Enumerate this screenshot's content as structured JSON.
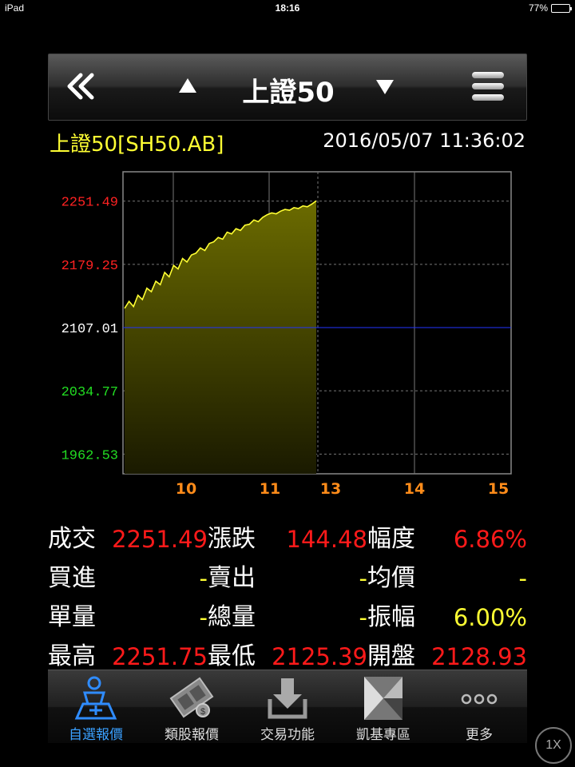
{
  "status_bar": {
    "device": "iPad",
    "time": "18:16",
    "battery": "77%",
    "battery_level": 0.77
  },
  "nav": {
    "title": "上證50",
    "back_icon": "double-chevron-left-icon",
    "prev_icon": "up-triangle-icon",
    "next_icon": "down-triangle-icon",
    "menu_icon": "hamburger-menu-icon"
  },
  "quote": {
    "name": "上證50[SH50.AB]",
    "datetime": "2016/05/07 11:36:02"
  },
  "chart_data": {
    "type": "area",
    "y_ticks": [
      {
        "label": "2251.49",
        "value": 2251.49,
        "color": "#ff2222"
      },
      {
        "label": "2179.25",
        "value": 2179.25,
        "color": "#ff2222"
      },
      {
        "label": "2107.01",
        "value": 2107.01,
        "color": "#ffffff"
      },
      {
        "label": "2034.77",
        "value": 2034.77,
        "color": "#22dd22"
      },
      {
        "label": "1962.53",
        "value": 1962.53,
        "color": "#22dd22"
      }
    ],
    "x_ticks": [
      "10",
      "11",
      "13",
      "14",
      "15"
    ],
    "ylim": [
      1940,
      2285
    ],
    "reference_line": 2107.01,
    "series": [
      {
        "values": [
          2128.93,
          2137,
          2131,
          2144,
          2139,
          2152,
          2148,
          2160,
          2156,
          2170,
          2165,
          2178,
          2174,
          2186,
          2182,
          2190,
          2192,
          2198,
          2195,
          2203,
          2205,
          2210,
          2208,
          2216,
          2214,
          2220,
          2218,
          2224,
          2225,
          2230,
          2228,
          2233,
          2236,
          2238,
          2237,
          2240,
          2242,
          2241,
          2244,
          2243,
          2246,
          2245,
          2248,
          2251.75
        ]
      }
    ],
    "colors": {
      "line": "#ffff33",
      "fill_top": "#6b6b00",
      "fill_bottom": "#1a1a00",
      "ref": "#2233ff",
      "grid": "#777777"
    }
  },
  "stats": [
    [
      {
        "label": "成交",
        "value": "2251.49",
        "color": "red"
      },
      {
        "label": "漲跌",
        "value": "144.48",
        "color": "red"
      },
      {
        "label": "幅度",
        "value": "6.86%",
        "color": "red"
      }
    ],
    [
      {
        "label": "買進",
        "value": "-",
        "color": "yellow"
      },
      {
        "label": "賣出",
        "value": "-",
        "color": "yellow"
      },
      {
        "label": "均價",
        "value": "-",
        "color": "yellow"
      }
    ],
    [
      {
        "label": "單量",
        "value": "-",
        "color": "yellow"
      },
      {
        "label": "總量",
        "value": "-",
        "color": "yellow"
      },
      {
        "label": "振幅",
        "value": "6.00%",
        "color": "yellow"
      }
    ],
    [
      {
        "label": "最高",
        "value": "2251.75",
        "color": "red"
      },
      {
        "label": "最低",
        "value": "2125.39",
        "color": "red"
      },
      {
        "label": "開盤",
        "value": "2128.93",
        "color": "red"
      }
    ]
  ],
  "tabs": [
    {
      "label": "自選報價",
      "icon": "watchlist-person-icon",
      "active": true
    },
    {
      "label": "類股報價",
      "icon": "film-coin-icon",
      "active": false
    },
    {
      "label": "交易功能",
      "icon": "download-tray-icon",
      "active": false
    },
    {
      "label": "凱基專區",
      "icon": "kgi-logo-icon",
      "active": false
    },
    {
      "label": "更多",
      "icon": "more-dots-icon",
      "active": false
    }
  ],
  "zoom_badge": "1X"
}
